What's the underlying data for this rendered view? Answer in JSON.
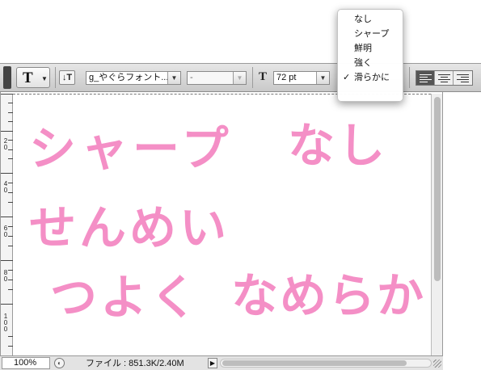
{
  "toolbar": {
    "tool_glyph": "T",
    "orientation_glyph": "↓T",
    "font_family": "g_やぐらフォント...",
    "font_style": "-",
    "size_glyph": "T",
    "font_size": "72 pt",
    "dropdown_arrow": "▼",
    "align_options": [
      "left",
      "center",
      "right"
    ],
    "align_selected": "left"
  },
  "antialias_menu": {
    "items": [
      {
        "label": "なし",
        "checked": false
      },
      {
        "label": "シャープ",
        "checked": false
      },
      {
        "label": "鮮明",
        "checked": false
      },
      {
        "label": "強く",
        "checked": false
      },
      {
        "label": "滑らかに",
        "checked": true
      }
    ],
    "check_mark": "✓"
  },
  "ruler": {
    "labels": [
      "20",
      "40",
      "60",
      "80",
      "100"
    ]
  },
  "canvas": {
    "text_color": "#f48fc6",
    "lines": [
      {
        "text": "シャープ"
      },
      {
        "text": "なし"
      },
      {
        "text": "せんめい"
      },
      {
        "text": "つよく"
      },
      {
        "text": "なめらか"
      }
    ]
  },
  "status": {
    "zoom": "100%",
    "file_info": "ファイル : 851.3K/2.40M",
    "menu_arrow": "▶"
  }
}
